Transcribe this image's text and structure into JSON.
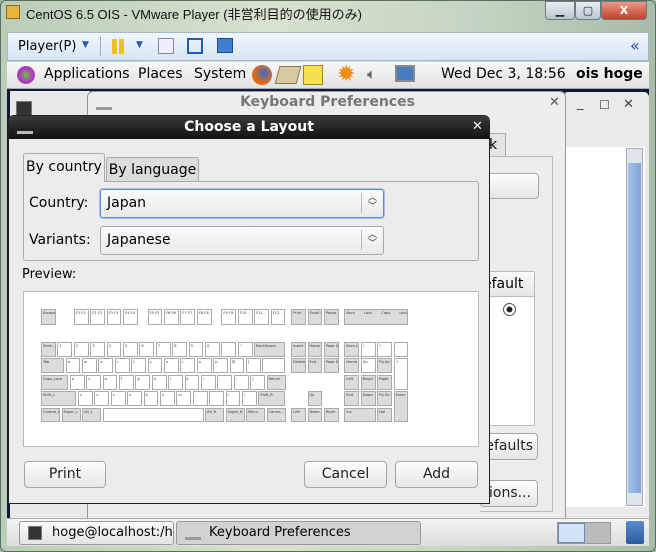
{
  "vmware": {
    "title": "CentOS 6.5 OIS - VMware Player (非営利目的の使用のみ)",
    "menu": "Player(P)",
    "collapse": "«"
  },
  "panel": {
    "applications": "Applications",
    "places": "Places",
    "system": "System",
    "clock": "Wed Dec  3, 18:56",
    "user": "ois hoge"
  },
  "kbprefs": {
    "title": "Keyboard Preferences",
    "tab_fragment": "k",
    "column_fragment": "efault",
    "defaults_fragment": "efaults",
    "options_fragment": "ions..."
  },
  "dialog": {
    "title": "Choose a Layout",
    "tabs": [
      {
        "label": "By country",
        "selected": true
      },
      {
        "label": "By language",
        "selected": false
      }
    ],
    "country_label": "Country:",
    "country_value": "Japan",
    "variants_label": "Variants:",
    "variants_value": "Japanese",
    "preview_label": "Preview:",
    "print": "Print",
    "cancel": "Cancel",
    "add": "Add"
  },
  "keyboard": {
    "frow": [
      "Escape",
      "F1 F1",
      "F2 F2",
      "F3 F3",
      "F4 F4",
      "F5 F5",
      "F6 F6",
      "F7 F7",
      "F8 F8",
      "F9 F9",
      "F10...",
      "F11...",
      "F12...",
      "Print",
      "Scroll Lock",
      "Pause"
    ],
    "leds": [
      "Num Lock",
      "Caps Lock",
      "Scroll Lock"
    ],
    "rows": [
      [
        "Zenk...",
        "1",
        "2",
        "3",
        "4",
        "5",
        "6",
        "7",
        "8",
        "9",
        "0",
        "-",
        "^",
        "BackSpace"
      ],
      [
        "Tab",
        "q",
        "w",
        "e",
        "r",
        "t",
        "y",
        "u",
        "i",
        "o",
        "p",
        "@",
        "[",
        ""
      ],
      [
        "Caps_Lock",
        "a",
        "s",
        "d",
        "f",
        "g",
        "h",
        "j",
        "k",
        "l",
        ";",
        ":",
        "]",
        "Return"
      ],
      [
        "Shift_L",
        "z",
        "x",
        "c",
        "v",
        "b",
        "n",
        "m",
        ",",
        ".",
        "/",
        "\\",
        "Shift_R"
      ],
      [
        "Control_L",
        "Super_L",
        "Alt_L",
        "",
        "Alt_R",
        "Super_R",
        "Menu",
        "Contro..."
      ]
    ],
    "nav": [
      "Insert",
      "Home",
      "Page Up",
      "Delete",
      "End",
      "Page Down",
      "Up",
      "Left",
      "Down",
      "Right"
    ],
    "numpad": [
      "Num Lock",
      "/",
      "*",
      "-",
      "Home",
      "Up",
      "Pg Up",
      "+",
      "Left",
      "Begin",
      "Right",
      "End",
      "Down",
      "Pg Dn",
      "Enter",
      "Ins",
      "Del"
    ]
  },
  "taskbar": {
    "items": [
      "hoge@localhost:/hom...",
      "Keyboard Preferences"
    ]
  }
}
